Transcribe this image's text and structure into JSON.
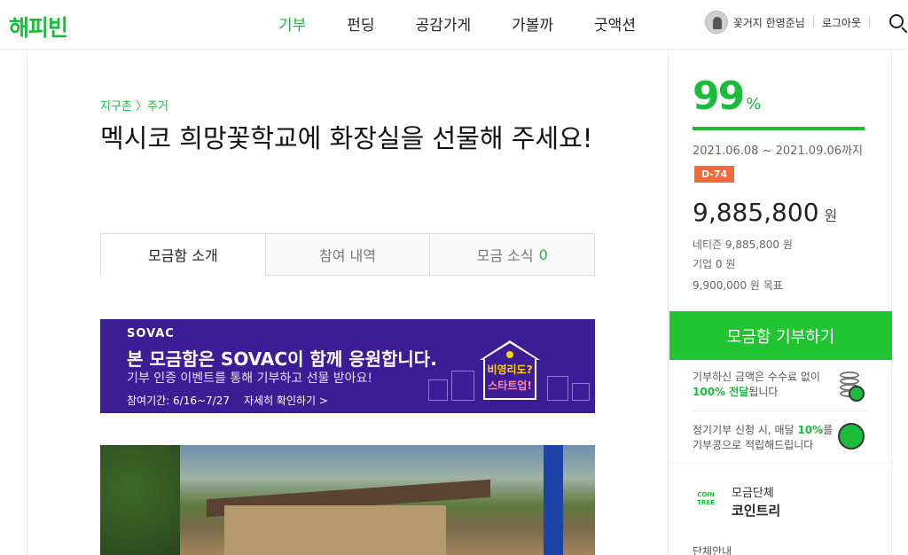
{
  "header": {
    "logo": "해피빈",
    "nav": [
      {
        "label": "기부",
        "active": true
      },
      {
        "label": "펀딩",
        "active": false
      },
      {
        "label": "공감가게",
        "active": false
      },
      {
        "label": "가볼까",
        "active": false
      },
      {
        "label": "굿액션",
        "active": false
      }
    ],
    "user_name": "꽃거지 한영준님",
    "logout": "로그아웃",
    "search_icon": "search-icon",
    "brand_color": "#1bbc3a"
  },
  "main": {
    "breadcrumb": "지구촌 〉주거",
    "title": "멕시코 희망꽃학교에 화장실을 선물해 주세요!",
    "tabs": [
      {
        "label": "모금함 소개",
        "count": "",
        "active": true
      },
      {
        "label": "참여 내역",
        "count": "",
        "active": false
      },
      {
        "label": "모금 소식",
        "count": "0",
        "active": false
      }
    ],
    "banner": {
      "brand": "SOVAC",
      "headline": "본 모금함은 SOVAC이 함께 응원합니다.",
      "sub": "기부 인증 이벤트를 통해 기부하고 선물 받아요!",
      "period": "참여기간: 6/16~7/27",
      "link": "자세히 확인하기 >",
      "badge_line1": "비영리도?",
      "badge_line2": "스타트업!",
      "bg_color": "#3c1d96"
    }
  },
  "side": {
    "percent": "99",
    "percent_sign": "%",
    "progress_fraction": 0.99,
    "period": "2021.06.08 ~ 2021.09.06까지",
    "dday": "D-74",
    "amount": "9,885,800",
    "amount_unit": "원",
    "netizen": "네티즌 9,885,800 원",
    "company": "기업 0 원",
    "goal": "9,900,000 원 목표",
    "donate_button": "모금함 기부하기",
    "info1_line1": "기부하신 금액은 수수료 없이",
    "info1_bold": "100% 전달",
    "info1_rest": "됩니다",
    "info2_line1_pre": "정기기부 신청 시, 매달 ",
    "info2_bold": "10%",
    "info2_line1_post": "를",
    "info2_line2": "기부콩으로 적립해드립니다",
    "org_logo": "COIN TREE",
    "org_label": "모금단체",
    "org_name": "코인트리",
    "org_more": "단체안내"
  }
}
